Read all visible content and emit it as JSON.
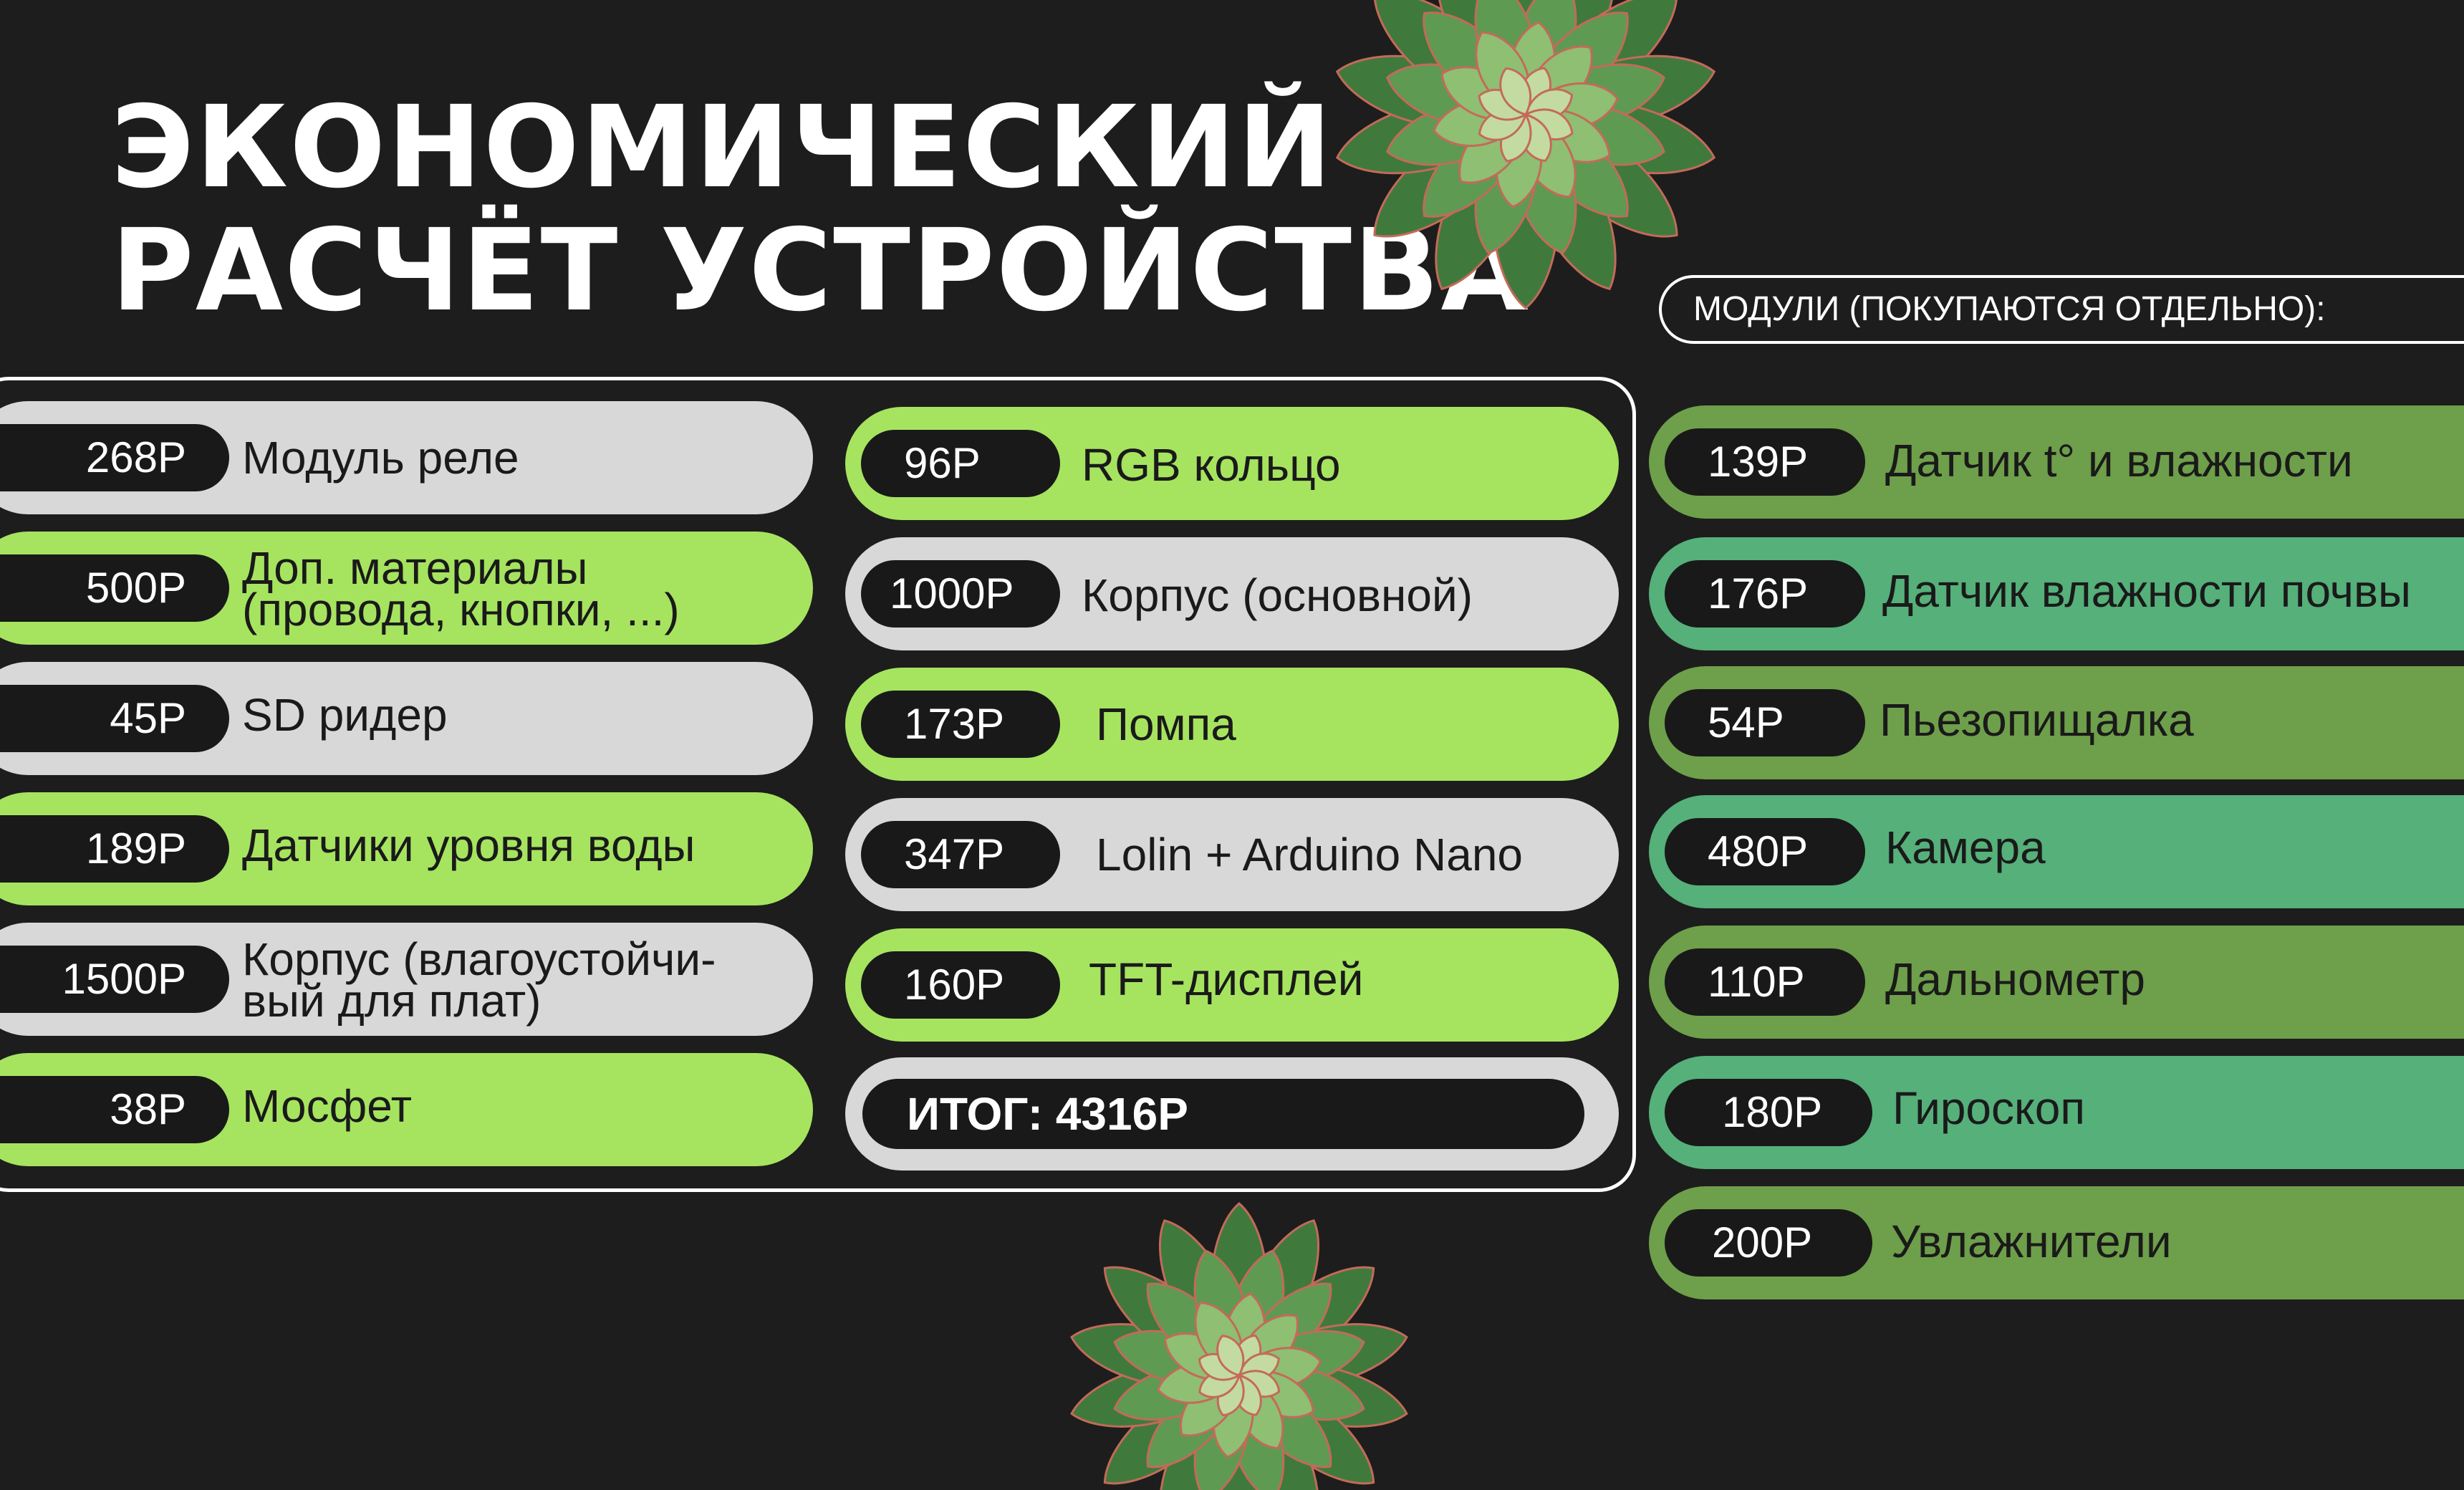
{
  "title": {
    "line1": "ЭКОНОМИЧЕСКИЙ",
    "line2": "РАСЧЁТ УСТРОЙСТВА"
  },
  "modules_header": "МОДУЛИ (ПОКУПАЮТСЯ ОТДЕЛЬНО):",
  "colors": {
    "background": "#1d1d1d",
    "light_green": "#a6e460",
    "light_gray": "#d8d8d8",
    "olive_green": "#6e9f4a",
    "teal_green": "#55b07a",
    "price_pill": "#191919"
  },
  "left_column": [
    {
      "price": "268Р",
      "label": "Модуль реле",
      "color": "#d8d8d8"
    },
    {
      "price": "500Р",
      "label": "Доп. материалы\n(провода, кнопки, ...)",
      "color": "#a6e460"
    },
    {
      "price": "45Р",
      "label": "SD ридер",
      "color": "#d8d8d8"
    },
    {
      "price": "189Р",
      "label": "Датчики уровня воды",
      "color": "#a6e460"
    },
    {
      "price": "1500Р",
      "label": "Корпус (влагоустойчи-\nвый для плат)",
      "color": "#d8d8d8"
    },
    {
      "price": "38Р",
      "label": "Мосфет",
      "color": "#a6e460"
    }
  ],
  "middle_column": [
    {
      "price": "96Р",
      "label": "RGB кольцо",
      "color": "#a6e460"
    },
    {
      "price": "1000Р",
      "label": "Корпус (основной)",
      "color": "#d8d8d8"
    },
    {
      "price": "173Р",
      "label": "Помпа",
      "color": "#a6e460"
    },
    {
      "price": "347Р",
      "label": "Lolin + Arduino Nano",
      "color": "#d8d8d8"
    },
    {
      "price": "160Р",
      "label": "TFT-дисплей",
      "color": "#a6e460"
    }
  ],
  "total": "ИТОГ: 4316Р",
  "modules_column": [
    {
      "price": "139Р",
      "label": "Датчик t° и влажности",
      "color": "#6e9f4a"
    },
    {
      "price": "176Р",
      "label": "Датчик влажности почвы",
      "color": "#55b07a"
    },
    {
      "price": "54Р",
      "label": "Пьезопищалка",
      "color": "#6e9f4a"
    },
    {
      "price": "480Р",
      "label": "Камера",
      "color": "#55b07a"
    },
    {
      "price": "110Р",
      "label": "Дальнометр",
      "color": "#6e9f4a"
    },
    {
      "price": "180Р",
      "label": "Гироскоп",
      "color": "#55b07a"
    },
    {
      "price": "200Р",
      "label": "Увлажнители",
      "color": "#6e9f4a"
    }
  ],
  "decorations": {
    "top_plant": "succulent-icon",
    "bottom_plant": "succulent-icon"
  }
}
